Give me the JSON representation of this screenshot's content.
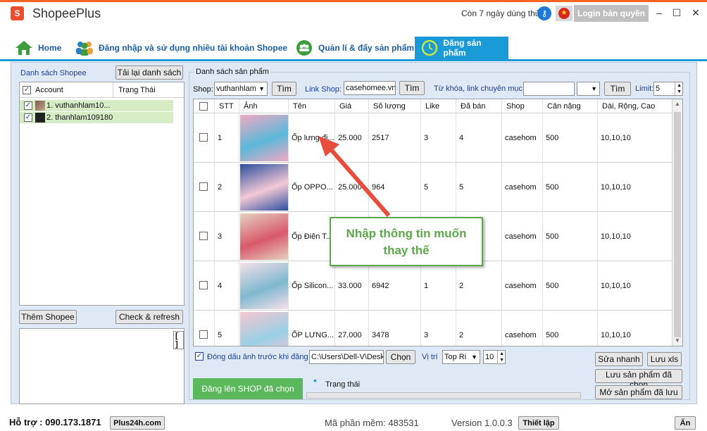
{
  "app": {
    "logo": "S",
    "title": "ShopeePlus",
    "trial_text": "Còn 7 ngày dùng thử",
    "login_label": "Login bản quyền",
    "minimize": "–",
    "maximize": "☐",
    "close": "✕"
  },
  "tabs": [
    {
      "label": "Home",
      "icon": "home-icon"
    },
    {
      "label": "Đăng nhập và sử dụng nhiều tài khoản Shopee",
      "icon": "users-icon"
    },
    {
      "label": "Quản lí & đẩy sản phẩm",
      "icon": "group-icon"
    },
    {
      "label": "Đăng sản phẩm",
      "icon": "clock-icon",
      "active": true
    }
  ],
  "left_panel": {
    "title": "Danh sách Shopee",
    "reload_label": "Tải lại danh sách",
    "col_account": "Account",
    "col_status": "Trạng Thái",
    "accounts": [
      {
        "name": "1. vuthanhlam10...",
        "checked": true
      },
      {
        "name": "2. thanhlam109180",
        "checked": true
      }
    ],
    "add_label": "Thêm Shopee",
    "check_label": "Check & refresh",
    "log_badge": "[ ]"
  },
  "right_panel": {
    "title": "Danh sách sản phẩm",
    "shop_label": "Shop:",
    "shop_value": "vuthanhlam",
    "find_label": "Tìm",
    "link_label": "Link Shop:",
    "link_value": "casehomee.vn",
    "keyword_label": "Từ khóa, link chuyên mục:",
    "keyword_value": "",
    "limit_label": "Limit:",
    "limit_value": "5",
    "columns": [
      "STT",
      "Ảnh",
      "Tên",
      "Giá",
      "Số lượng",
      "Like",
      "Đã bán",
      "Shop",
      "Cân nặng",
      "Dài, Rộng, Cao"
    ],
    "rows": [
      {
        "stt": "1",
        "name": "Ốp lưng đi...",
        "price": "25.000",
        "qty": "2517",
        "like": "3",
        "sold": "4",
        "shop": "casehom",
        "weight": "500",
        "dims": "10,10,10"
      },
      {
        "stt": "2",
        "name": "Ốp OPPO...",
        "price": "25.000",
        "qty": "964",
        "like": "5",
        "sold": "5",
        "shop": "casehom",
        "weight": "500",
        "dims": "10,10,10"
      },
      {
        "stt": "3",
        "name": "Ốp Điện T...",
        "price": "",
        "qty": "",
        "like": "",
        "sold": "",
        "shop": "casehom",
        "weight": "500",
        "dims": "10,10,10"
      },
      {
        "stt": "4",
        "name": "Ốp Silicon...",
        "price": "33.000",
        "qty": "6942",
        "like": "1",
        "sold": "2",
        "shop": "casehom",
        "weight": "500",
        "dims": "10,10,10"
      },
      {
        "stt": "5",
        "name": "ỐP LƯNG...",
        "price": "27.000",
        "qty": "3478",
        "like": "3",
        "sold": "2",
        "shop": "casehom",
        "weight": "500",
        "dims": "10,10,10"
      }
    ],
    "watermark_label": "Đóng dấu ảnh trước khi đăng",
    "path_value": "C:\\Users\\Dell-V\\Desk",
    "choose_label": "Chọn",
    "position_label": "Vị trí",
    "position_value": "Top Ri",
    "size_value": "10",
    "quick_edit_label": "Sửa nhanh",
    "save_xls_label": "Lưu xls",
    "save_selected_label": "Lưu sản phẩm đã chọn",
    "open_saved_label": "Mở sản phẩm đã lưu",
    "post_label": "Đăng lên SHOP đã chọn",
    "status_label": "Trạng thái",
    "status_dot": "•"
  },
  "callout": {
    "line1": "Nhập thông tin muốn",
    "line2": "thay thế"
  },
  "statusbar": {
    "support": "Hỗ trợ : 090.173.1871",
    "site": "Plus24h.com",
    "code": "Mã phần mềm: 483531",
    "version": "Version 1.0.0.3",
    "settings": "Thiết lập",
    "hide": "Ẩn"
  },
  "colors": {
    "accent": "#1a9bd7",
    "brand": "#ee4d2d",
    "green": "#5cb85c",
    "callout": "#5da84b",
    "arrow": "#e84c3d"
  }
}
